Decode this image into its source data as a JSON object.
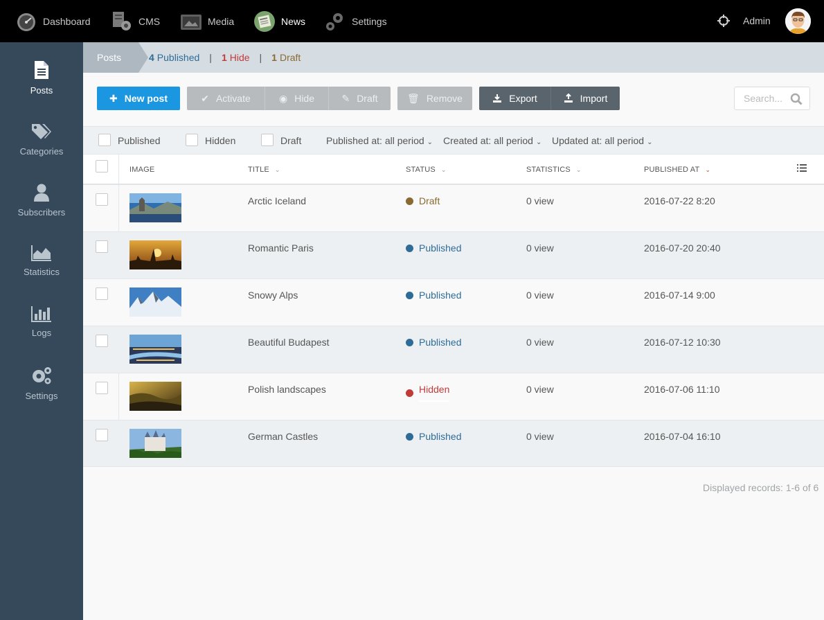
{
  "topnav": {
    "items": [
      {
        "label": "Dashboard",
        "icon": "speedometer-icon"
      },
      {
        "label": "CMS",
        "icon": "cms-icon"
      },
      {
        "label": "Media",
        "icon": "media-icon"
      },
      {
        "label": "News",
        "icon": "news-icon"
      },
      {
        "label": "Settings",
        "icon": "gears-icon"
      }
    ],
    "active": "News",
    "user_label": "Admin"
  },
  "sidebar": {
    "items": [
      {
        "label": "Posts",
        "icon": "document-icon"
      },
      {
        "label": "Categories",
        "icon": "tags-icon"
      },
      {
        "label": "Subscribers",
        "icon": "user-icon"
      },
      {
        "label": "Statistics",
        "icon": "area-chart-icon"
      },
      {
        "label": "Logs",
        "icon": "bar-chart-icon"
      },
      {
        "label": "Settings",
        "icon": "gears-icon"
      }
    ],
    "active": "Posts"
  },
  "breadcrumb": {
    "section": "Posts",
    "published_count": "4",
    "published_label": "Published",
    "hide_count": "1",
    "hide_label": "Hide",
    "draft_count": "1",
    "draft_label": "Draft",
    "separator": "|"
  },
  "toolbar": {
    "new_post": "New post",
    "activate": "Activate",
    "hide": "Hide",
    "draft": "Draft",
    "remove": "Remove",
    "export": "Export",
    "import": "Import",
    "search_placeholder": "Search..."
  },
  "filters": {
    "published": "Published",
    "hidden": "Hidden",
    "draft": "Draft",
    "published_at": "Published at: all period",
    "created_at": "Created at: all period",
    "updated_at": "Updated at: all period"
  },
  "table": {
    "columns": [
      "IMAGE",
      "TITLE",
      "STATUS",
      "STATISTICS",
      "PUBLISHED AT"
    ],
    "rows": [
      {
        "title": "Arctic Iceland",
        "status": "Draft",
        "statistics": "0 view",
        "published_at": "2016-07-22 8:20"
      },
      {
        "title": "Romantic Paris",
        "status": "Published",
        "statistics": "0 view",
        "published_at": "2016-07-20 20:40"
      },
      {
        "title": "Snowy Alps",
        "status": "Published",
        "statistics": "0 view",
        "published_at": "2016-07-14 9:00"
      },
      {
        "title": "Beautiful Budapest",
        "status": "Published",
        "statistics": "0 view",
        "published_at": "2016-07-12 10:30"
      },
      {
        "title": "Polish landscapes",
        "status": "Hidden",
        "statistics": "0 view",
        "published_at": "2016-07-06 11:10"
      },
      {
        "title": "German Castles",
        "status": "Published",
        "statistics": "0 view",
        "published_at": "2016-07-04 16:10"
      }
    ]
  },
  "status_colors": {
    "Draft": "#8a6a32",
    "Published": "#2e6c97",
    "Hidden": "#c2393a"
  },
  "footer": {
    "records": "Displayed records: 1-6 of 6"
  }
}
